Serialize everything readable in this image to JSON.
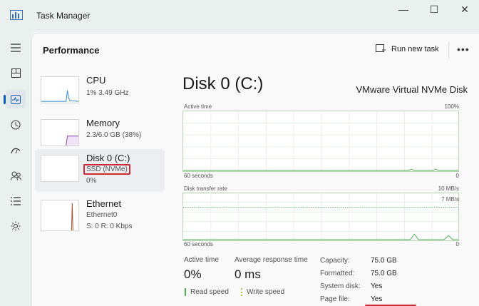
{
  "window": {
    "title": "Task Manager",
    "minimize": "—",
    "maximize": "☐",
    "close": "✕"
  },
  "rail": [
    {
      "icon": "hamburger-icon",
      "active": false
    },
    {
      "icon": "processes-icon",
      "active": false
    },
    {
      "icon": "performance-icon",
      "active": true
    },
    {
      "icon": "app-history-icon",
      "active": false
    },
    {
      "icon": "startup-apps-icon",
      "active": false
    },
    {
      "icon": "users-icon",
      "active": false
    },
    {
      "icon": "details-icon",
      "active": false
    },
    {
      "icon": "services-icon",
      "active": false
    }
  ],
  "header": {
    "title": "Performance",
    "run_new_task": "Run new task",
    "more": "•••"
  },
  "devices": {
    "cpu": {
      "name": "CPU",
      "sub1": "1%  3.49 GHz"
    },
    "memory": {
      "name": "Memory",
      "sub1": "2.3/6.0 GB (38%)"
    },
    "disk": {
      "name": "Disk 0 (C:)",
      "sub1": "SSD (NVMe)",
      "sub2": "0%"
    },
    "ethernet": {
      "name": "Ethernet",
      "sub1": "Ethernet0",
      "sub2": "S: 0  R: 0 Kbps"
    }
  },
  "detail": {
    "title": "Disk 0 (C:)",
    "model": "VMware Virtual NVMe Disk",
    "graph1": {
      "label": "Active time",
      "max": "100%",
      "time": "60 seconds",
      "min": "0"
    },
    "graph2": {
      "label": "Disk transfer rate",
      "max": "10 MB/s",
      "mid": "7 MB/s",
      "time": "60 seconds",
      "min": "0"
    },
    "stats": {
      "active_time_label": "Active time",
      "active_time_value": "0%",
      "resp_label": "Average response time",
      "resp_value": "0 ms",
      "read_speed": "Read speed",
      "write_speed": "Write speed"
    },
    "info": [
      {
        "k": "Capacity:",
        "v": "75.0 GB"
      },
      {
        "k": "Formatted:",
        "v": "75.0 GB"
      },
      {
        "k": "System disk:",
        "v": "Yes"
      },
      {
        "k": "Page file:",
        "v": "Yes"
      }
    ]
  },
  "colors": {
    "accent": "#0a5bb5",
    "highlight": "#cc2b36",
    "graph_border": "#b7d7b3",
    "disk_line": "#4caf50",
    "cpu_line": "#2b88d8",
    "mem_line": "#8e44ad",
    "eth_line": "#a0522d"
  }
}
